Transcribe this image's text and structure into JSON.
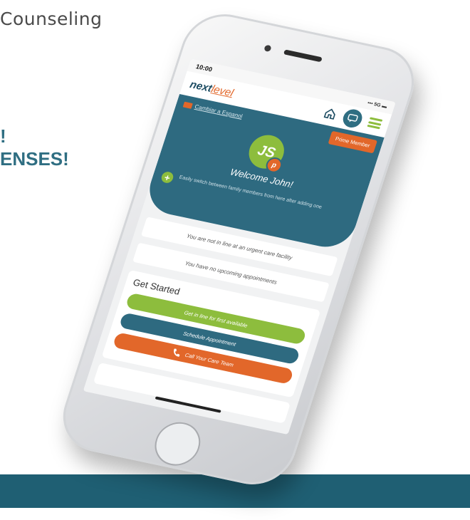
{
  "background": {
    "heading": "Counseling",
    "line1": "!",
    "line2": "ENSES!"
  },
  "colors": {
    "teal": "#2e6a80",
    "green": "#8dbd3d",
    "orange": "#e2672a",
    "band": "#1f5f73"
  },
  "status_bar": {
    "time": "10:00",
    "indicators": "••• 5G ▬"
  },
  "nav": {
    "logo_main": "next",
    "logo_accent": "level",
    "home_icon": "home-icon",
    "chat_icon": "chat-icon",
    "menu_icon": "hamburger-menu-icon"
  },
  "hero": {
    "language_link": "Cambiar a Espanol",
    "member_button": "Prime Member",
    "avatar_initials": "JS",
    "avatar_badge": "p",
    "welcome": "Welcome John!",
    "add_family_text": "Easily switch between family members from here after adding one"
  },
  "status_cards": {
    "queue": "You are not in line at an urgent care facility",
    "appointments": "You have no upcoming appointments"
  },
  "get_started": {
    "title": "Get Started",
    "actions": [
      {
        "label": "Get in line for first available"
      },
      {
        "label": "Schedule Appointment"
      },
      {
        "label": "Call Your Care Team"
      }
    ]
  }
}
